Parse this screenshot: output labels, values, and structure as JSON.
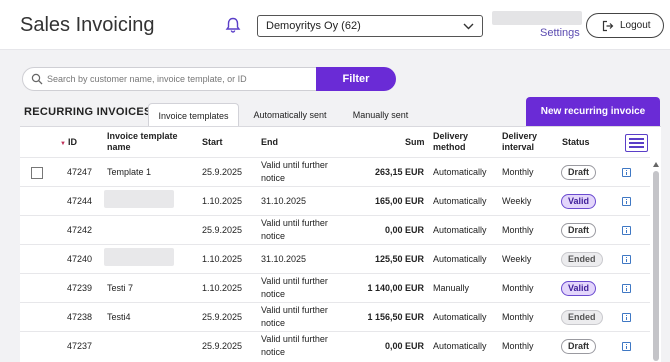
{
  "header": {
    "app_title": "Sales Invoicing",
    "company": "Demoyritys Oy (62)",
    "settings_label": "Settings",
    "logout_label": "Logout"
  },
  "search": {
    "placeholder": "Search by customer name, invoice template, or ID",
    "value": "",
    "filter_label": "Filter"
  },
  "section": {
    "title": "RECURRING INVOICES",
    "tabs": [
      {
        "label": "Invoice templates",
        "active": true
      },
      {
        "label": "Automatically sent",
        "active": false
      },
      {
        "label": "Manually sent",
        "active": false
      }
    ],
    "new_button": "New recurring invoice"
  },
  "table": {
    "columns": {
      "id": "ID",
      "name_line1": "Invoice template",
      "name_line2": "name",
      "start": "Start",
      "end": "End",
      "sum": "Sum",
      "method_line1": "Delivery",
      "method_line2": "method",
      "interval_line1": "Delivery",
      "interval_line2": "interval",
      "status": "Status"
    },
    "rows": [
      {
        "id": "47247",
        "name": "Template 1",
        "start": "25.9.2025",
        "end_1": "Valid until further",
        "end_2": "notice",
        "sum": "263,15 EUR",
        "method": "Automatically",
        "interval": "Monthly",
        "status": "Draft"
      },
      {
        "id": "47244",
        "name": "",
        "start": "1.10.2025",
        "end_1": "31.10.2025",
        "end_2": "",
        "sum": "165,00 EUR",
        "method": "Automatically",
        "interval": "Weekly",
        "status": "Valid"
      },
      {
        "id": "47242",
        "name": "",
        "start": "25.9.2025",
        "end_1": "Valid until further",
        "end_2": "notice",
        "sum": "0,00 EUR",
        "method": "Automatically",
        "interval": "Monthly",
        "status": "Draft"
      },
      {
        "id": "47240",
        "name": "",
        "start": "1.10.2025",
        "end_1": "31.10.2025",
        "end_2": "",
        "sum": "125,50 EUR",
        "method": "Automatically",
        "interval": "Weekly",
        "status": "Ended"
      },
      {
        "id": "47239",
        "name": "Testi 7",
        "start": "1.10.2025",
        "end_1": "Valid until further",
        "end_2": "notice",
        "sum": "1 140,00 EUR",
        "method": "Manually",
        "interval": "Monthly",
        "status": "Valid"
      },
      {
        "id": "47238",
        "name": "Testi4",
        "start": "25.9.2025",
        "end_1": "Valid until further",
        "end_2": "notice",
        "sum": "1 156,50 EUR",
        "method": "Automatically",
        "interval": "Monthly",
        "status": "Ended"
      },
      {
        "id": "47237",
        "name": "",
        "start": "25.9.2025",
        "end_1": "Valid until further",
        "end_2": "notice",
        "sum": "0,00 EUR",
        "method": "Automatically",
        "interval": "Monthly",
        "status": "Draft"
      }
    ]
  },
  "colors": {
    "accent": "#6a2bd6",
    "valid_badge": "#e3d6fb",
    "ended_badge": "#ececee"
  }
}
